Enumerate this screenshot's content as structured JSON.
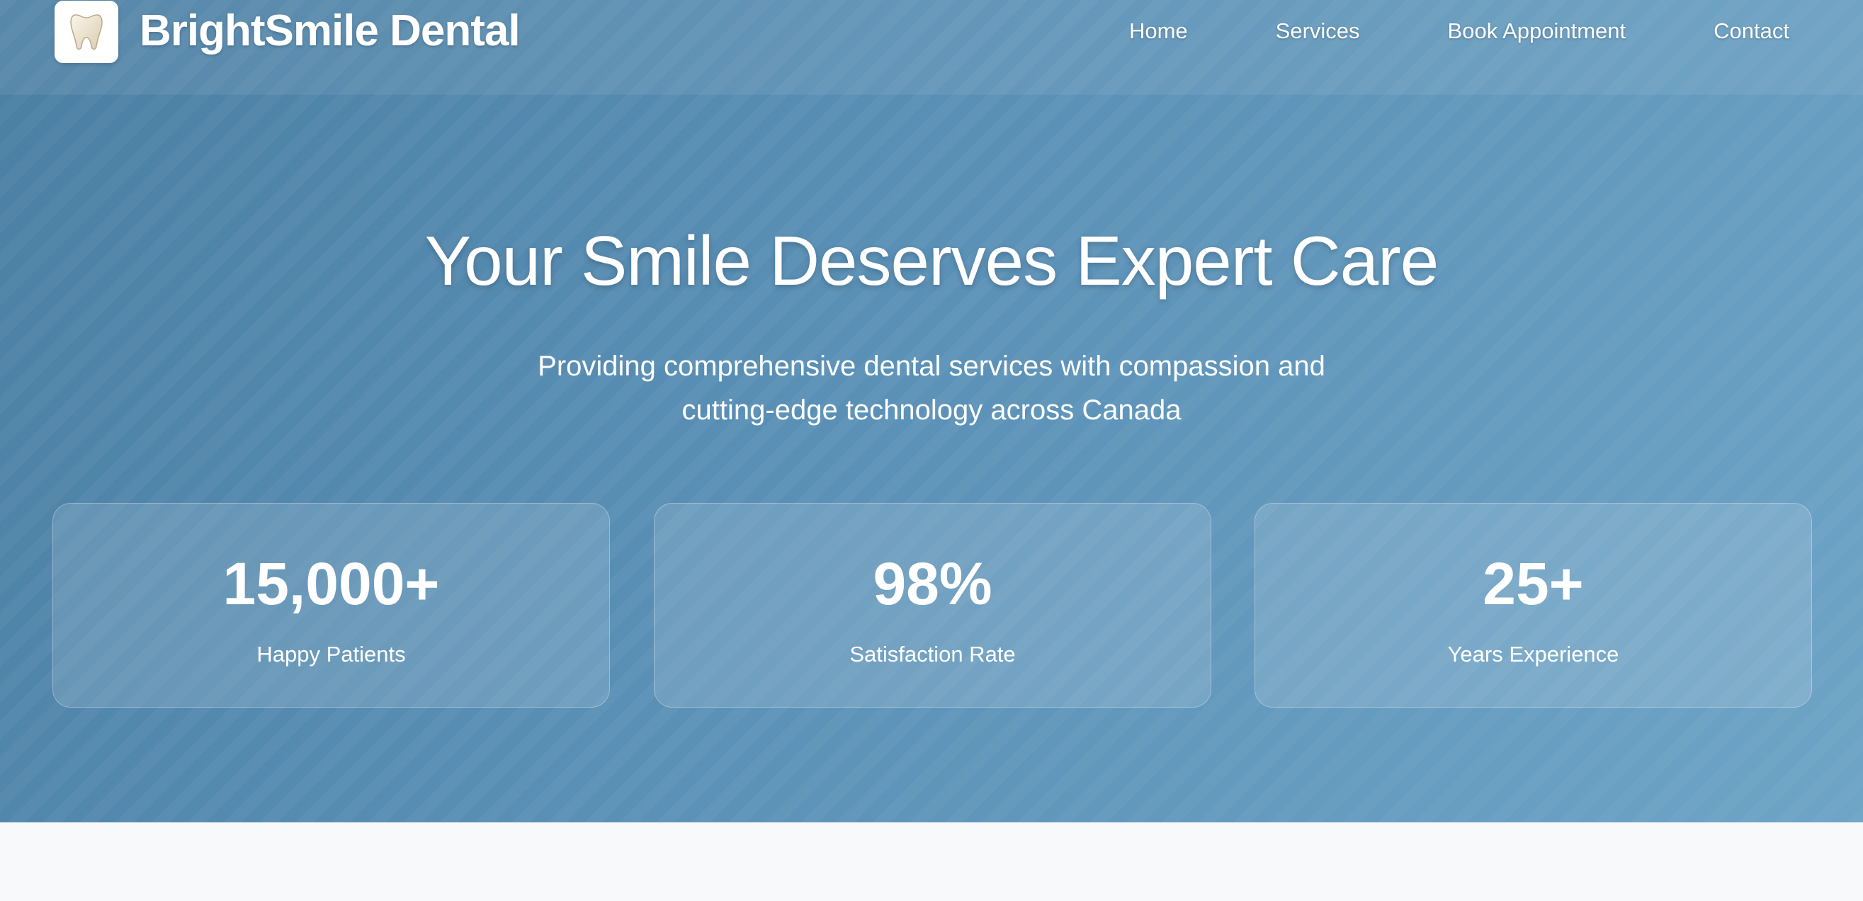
{
  "brand": {
    "name": "BrightSmile Dental",
    "logo_icon": "tooth-icon"
  },
  "nav": {
    "items": [
      {
        "label": "Home"
      },
      {
        "label": "Services"
      },
      {
        "label": "Book Appointment"
      },
      {
        "label": "Contact"
      }
    ]
  },
  "hero": {
    "title": "Your Smile Deserves Expert Care",
    "subtitle": "Providing comprehensive dental services with compassion and cutting-edge technology across Canada"
  },
  "stats": [
    {
      "value": "15,000+",
      "label": "Happy Patients"
    },
    {
      "value": "98%",
      "label": "Satisfaction Rate"
    },
    {
      "value": "25+",
      "label": "Years Experience"
    }
  ],
  "colors": {
    "hero_gradient_start": "#4b7fa3",
    "hero_gradient_end": "#6ea4c6",
    "text": "#ffffff",
    "page_background": "#f8f9fb"
  }
}
